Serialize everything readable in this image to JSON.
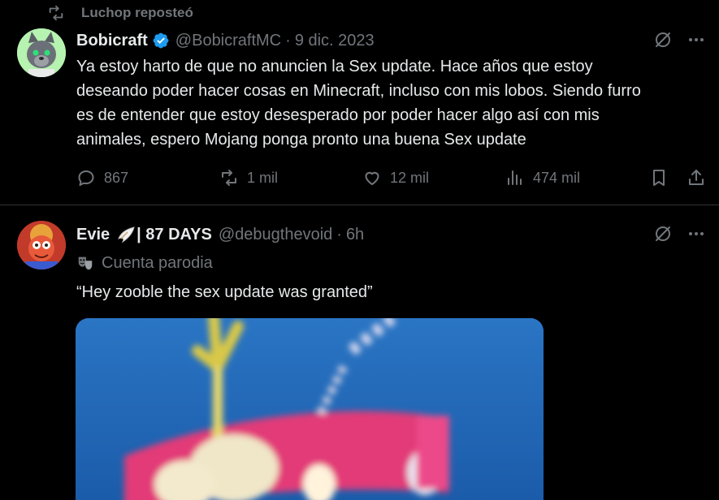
{
  "repost_bar": {
    "label": "Luchop reposteó"
  },
  "tweet1": {
    "name": "Bobicraft",
    "handle": "@BobicraftMC",
    "sep": "·",
    "date": "9 dic. 2023",
    "lines": [
      "Ya estoy harto de que no anuncien la Sex update. Hace años que estoy",
      "deseando poder hacer cosas en Minecraft, incluso con mis lobos. Siendo furro",
      "es de entender que estoy desesperado por poder hacer algo así con mis",
      "animales, espero Mojang ponga pronto una buena Sex update"
    ],
    "actions": {
      "replies": "867",
      "reposts": "1 mil",
      "likes": "12 mil",
      "views": "474 mil"
    }
  },
  "tweet2": {
    "name": "Evie",
    "badge_text": "| 87 DAYS",
    "handle": "@debugthevoid",
    "sep": "·",
    "time": "6h",
    "parody_label": "Cuenta parodia",
    "text": "“Hey zooble the sex update was granted”"
  },
  "colors": {
    "background": "#000000",
    "text": "#e7e9ea",
    "muted": "#71767b",
    "verified": "#1d9bf0",
    "divider": "#2f3336"
  },
  "icons": [
    "repost-icon",
    "verified-badge-icon",
    "grok-icon",
    "more-icon",
    "reply-icon",
    "like-icon",
    "views-icon",
    "bookmark-icon",
    "share-icon",
    "wing-emoji-icon",
    "parody-mask-icon"
  ]
}
